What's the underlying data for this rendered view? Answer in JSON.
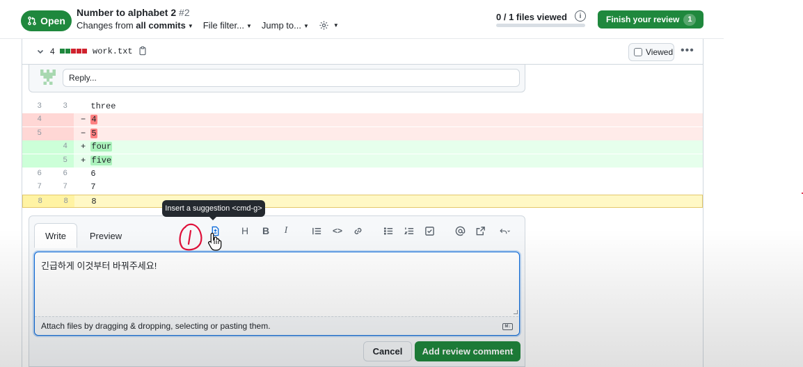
{
  "header": {
    "status_label": "Open",
    "pr_title": "Number to alphabet 2",
    "pr_number": "#2",
    "changes_prefix": "Changes from",
    "changes_value": "all commits",
    "file_filter": "File filter...",
    "jump_to": "Jump to...",
    "files_viewed": "0 / 1 files viewed",
    "files_viewed_fraction": 0,
    "info_glyph": "i",
    "finish_review_label": "Finish your review",
    "finish_review_count": "1"
  },
  "file": {
    "change_count": "4",
    "name": "work.txt",
    "viewed_label": "Viewed",
    "diffstat": [
      "#1f883d",
      "#1f883d",
      "#cf222e",
      "#cf222e",
      "#cf222e"
    ]
  },
  "reply": {
    "placeholder": "Reply..."
  },
  "diff_lines": [
    {
      "type": "context",
      "old": "3",
      "new": "3",
      "sign": " ",
      "text": "three"
    },
    {
      "type": "del",
      "old": "4",
      "new": "",
      "sign": "−",
      "text": "4"
    },
    {
      "type": "del",
      "old": "5",
      "new": "",
      "sign": "−",
      "text": "5"
    },
    {
      "type": "add",
      "old": "",
      "new": "4",
      "sign": "+",
      "text": "four"
    },
    {
      "type": "add",
      "old": "",
      "new": "5",
      "sign": "+",
      "text": "five"
    },
    {
      "type": "context",
      "old": "6",
      "new": "6",
      "sign": " ",
      "text": "6"
    },
    {
      "type": "context",
      "old": "7",
      "new": "7",
      "sign": " ",
      "text": "7"
    },
    {
      "type": "selected",
      "old": "8",
      "new": "8",
      "sign": " ",
      "text": "8"
    }
  ],
  "tooltip": "Insert a suggestion <cmd-g>",
  "editor": {
    "tab_write": "Write",
    "tab_preview": "Preview",
    "toolbar": {
      "heading": "H",
      "bold": "B",
      "italic": "I",
      "code_glyph": "<>"
    },
    "comment_text": "긴급하게 이것부터 바꿔주세요!",
    "attach_hint": "Attach files by dragging & dropping, selecting or pasting them.",
    "markdown_badge": "M↓",
    "cancel_label": "Cancel",
    "submit_label": "Add review comment"
  },
  "colors": {
    "green": "#1f883d",
    "blue": "#0969da",
    "annotation_red": "#e0103a"
  }
}
